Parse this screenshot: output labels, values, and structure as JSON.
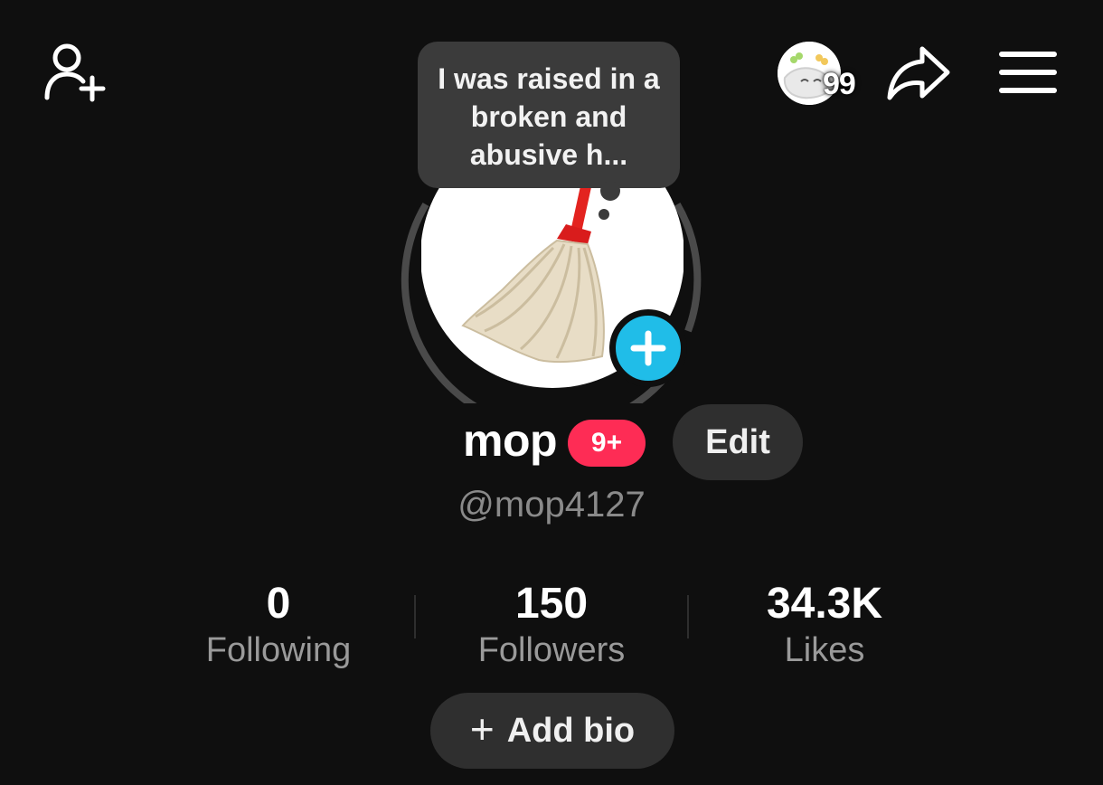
{
  "header": {
    "add_friend_icon": "person-plus-icon",
    "streak_count": "99",
    "streak_avatar_icon": "flower-face-icon",
    "share_icon": "share-arrow-icon",
    "menu_icon": "hamburger-menu-icon"
  },
  "profile": {
    "bubble_text": "I was raised in a broken and abusive h...",
    "avatar_image": "mop-photo",
    "add_avatar_icon": "plus-icon",
    "username": "mop",
    "notification_badge": "9+",
    "edit_label": "Edit",
    "handle": "@mop4127"
  },
  "stats": [
    {
      "value": "0",
      "label": "Following"
    },
    {
      "value": "150",
      "label": "Followers"
    },
    {
      "value": "34.3K",
      "label": "Likes"
    }
  ],
  "bio_button": {
    "plus": "+",
    "label": "Add bio"
  },
  "colors": {
    "background": "#0f0f0f",
    "badge_red": "#fe2c55",
    "plus_blue": "#20bde8",
    "button_gray": "#2f2f2f"
  }
}
